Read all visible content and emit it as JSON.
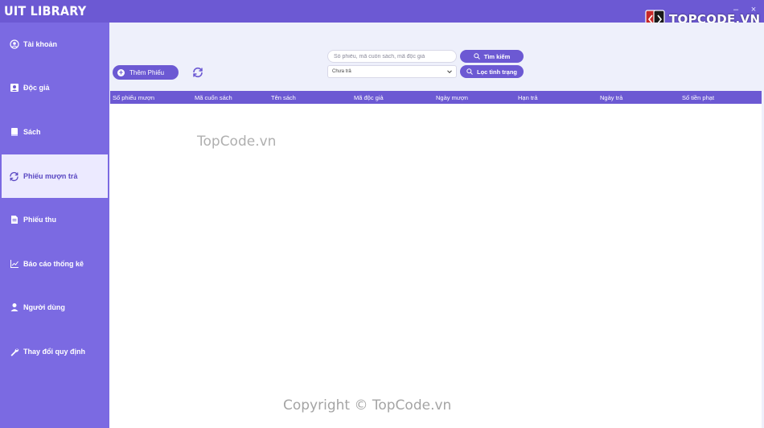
{
  "app": {
    "title": "UIT LIBRARY",
    "minimize": "–",
    "close": "×"
  },
  "logo": {
    "text": "TOPCODE.VN"
  },
  "sidebar": {
    "items": [
      {
        "label": "Tài khoản",
        "icon": "account-circle-icon",
        "active": false
      },
      {
        "label": "Độc giả",
        "icon": "reader-badge-icon",
        "active": false
      },
      {
        "label": "Sách",
        "icon": "book-icon",
        "active": false
      },
      {
        "label": "Phiếu mượn trả",
        "icon": "refresh-icon",
        "active": true
      },
      {
        "label": "Phiếu thu",
        "icon": "document-icon",
        "active": false
      },
      {
        "label": "Báo cáo thống kê",
        "icon": "chart-icon",
        "active": false
      },
      {
        "label": "Người dùng",
        "icon": "user-icon",
        "active": false
      },
      {
        "label": "Thay đổi quy định",
        "icon": "wrench-icon",
        "active": false
      }
    ]
  },
  "toolbar": {
    "add_label": "Thêm Phiếu",
    "search_placeholder": "Số phiếu, mã cuốn sách, mã độc giả",
    "search_button": "Tìm kiếm",
    "status_selected": "Chưa trả",
    "filter_button": "Lọc tình trạng"
  },
  "table": {
    "columns": [
      "Số phiếu mượn",
      "Mã cuốn sách",
      "Tên sách",
      "Mã độc giả",
      "Ngày mượn",
      "Hạn trả",
      "Ngày trả",
      "Số tiền phạt"
    ],
    "rows": []
  },
  "watermarks": {
    "center": "TopCode.vn",
    "bottom": "Copyright © TopCode.vn"
  },
  "colors": {
    "accent": "#6c59d3",
    "sidebar": "#7b6ae2",
    "active_bg": "#eceaff",
    "content_bg": "#eef0fb"
  }
}
